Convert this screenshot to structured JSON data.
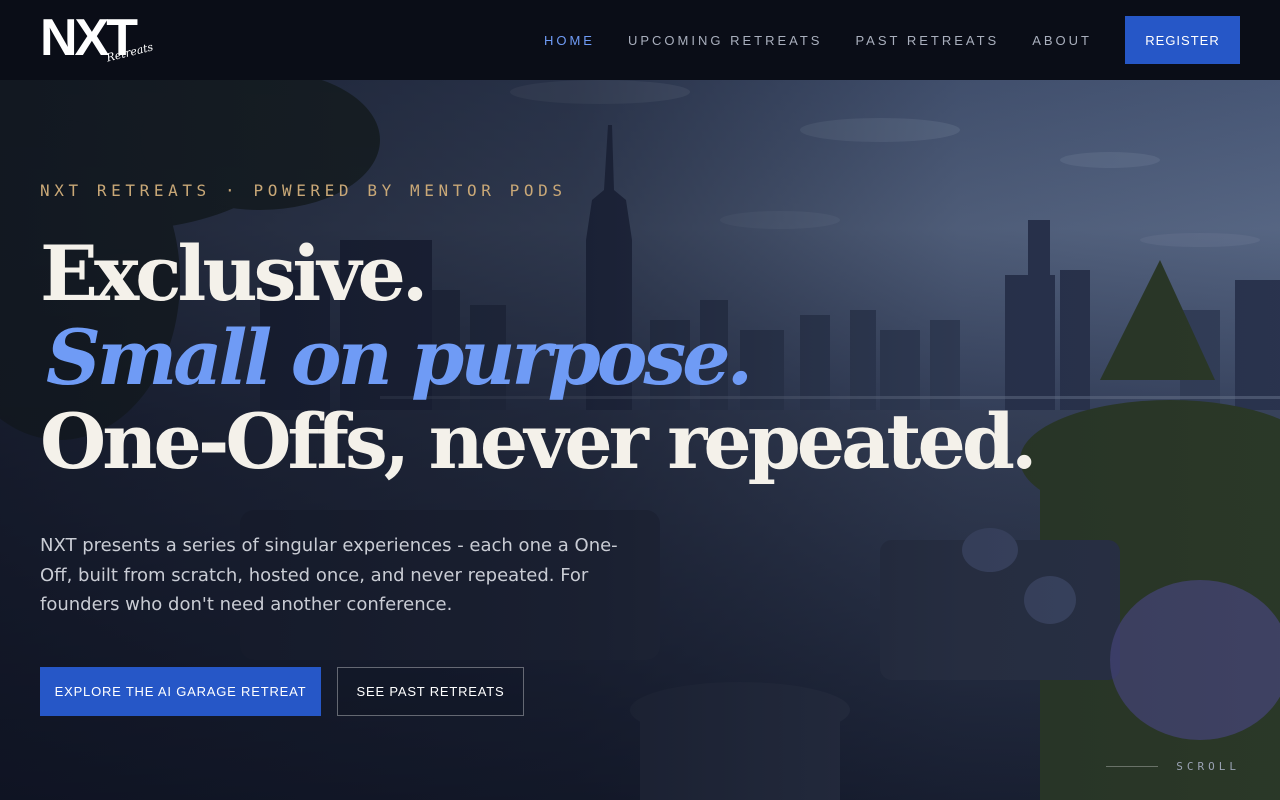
{
  "brand": {
    "logo_main": "NXT",
    "logo_script": "Retreats"
  },
  "nav": {
    "items": [
      {
        "label": "HOME",
        "active": true
      },
      {
        "label": "UPCOMING RETREATS",
        "active": false
      },
      {
        "label": "PAST RETREATS",
        "active": false
      },
      {
        "label": "ABOUT",
        "active": false
      }
    ],
    "register_label": "REGISTER"
  },
  "hero": {
    "eyebrow": "NXT RETREATS · POWERED BY MENTOR PODS",
    "headline_line1": "Exclusive.",
    "headline_line2": "Small on purpose.",
    "headline_line3": "One-Offs, never repeated.",
    "intro": "NXT presents a series of singular experiences - each one a One-Off, built from scratch, hosted once, and never repeated. For founders who don't need another conference.",
    "cta_primary": "EXPLORE THE AI GARAGE RETREAT",
    "cta_secondary": "SEE PAST RETREATS",
    "scroll_label": "SCROLL"
  },
  "colors": {
    "accent_blue": "#2657c7",
    "headline_accent": "#6f9bf5",
    "eyebrow_gold": "#c9a877",
    "header_bg": "#0a0d17"
  },
  "icons": {
    "background_image": "city-rooftop-terrace-image"
  }
}
